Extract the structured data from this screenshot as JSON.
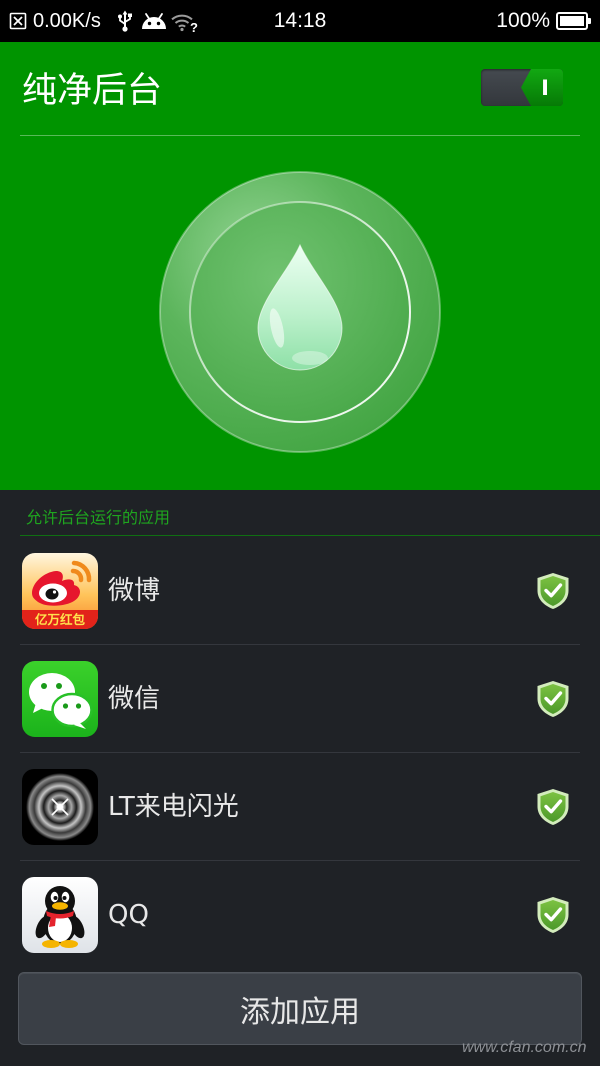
{
  "status_bar": {
    "notification_icon": "notification-blocked-icon",
    "net_speed": "0.00K/s",
    "usb_icon": "usb-icon",
    "debug_icon": "android-debug-icon",
    "wifi_icon": "wifi-no-internet-icon",
    "wifi_badge": "?",
    "time": "14:18",
    "battery_percent": "100%",
    "battery_icon": "battery-icon",
    "battery_level": 1.0
  },
  "header": {
    "title": "纯净后台",
    "toggle": {
      "on": true,
      "on_glyph": "I"
    },
    "orb_icon": "water-drop-icon"
  },
  "allowed_apps": {
    "section_label": "允许后台运行的应用",
    "items": [
      {
        "name": "微博",
        "icon": "weibo-app-icon",
        "icon_badge_text": "亿万红包",
        "status_icon": "shield-check-icon"
      },
      {
        "name": "微信",
        "icon": "wechat-app-icon",
        "status_icon": "shield-check-icon"
      },
      {
        "name": "LT来电闪光",
        "icon": "lt-flash-app-icon",
        "status_icon": "shield-check-icon"
      },
      {
        "name": "QQ",
        "icon": "qq-app-icon",
        "status_icon": "shield-check-icon"
      }
    ]
  },
  "add_button": {
    "label": "添加应用"
  },
  "watermark": {
    "text": "www.cfan.com.cn"
  },
  "colors": {
    "status_bar_bg": "#000000",
    "header_green": "#009400",
    "section_label_green": "#1fa51f",
    "list_bg": "#1f2226",
    "button_bg": "#3a3f46",
    "text_light": "#e8e8e8"
  }
}
